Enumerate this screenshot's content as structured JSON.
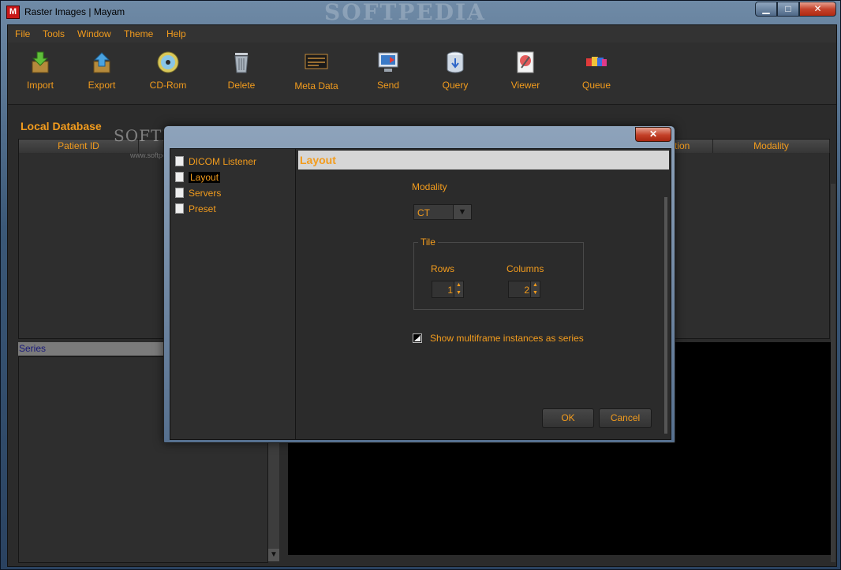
{
  "window": {
    "title": "Raster Images | Mayam",
    "app_icon_letter": "M",
    "watermark": "SOFTPEDIA",
    "controls": {
      "minimize": "▁",
      "maximize": "□",
      "close": "✕"
    }
  },
  "menu": [
    "File",
    "Tools",
    "Window",
    "Theme",
    "Help"
  ],
  "toolbar": [
    {
      "label": "Import",
      "icon": "import-icon"
    },
    {
      "label": "Export",
      "icon": "export-icon"
    },
    {
      "label": "CD-Rom",
      "icon": "cd-rom-icon"
    },
    {
      "label": "Delete",
      "icon": "trash-icon"
    },
    {
      "label": "Meta Data",
      "icon": "meta-data-icon"
    },
    {
      "label": "Send",
      "icon": "send-icon"
    },
    {
      "label": "Query",
      "icon": "query-icon"
    },
    {
      "label": "Viewer",
      "icon": "viewer-icon"
    },
    {
      "label": "Queue",
      "icon": "queue-icon"
    }
  ],
  "local_database": {
    "title": "Local Database",
    "columns": [
      "Patient ID",
      "tion",
      "Modality"
    ]
  },
  "series": {
    "header": "Series"
  },
  "watermark": {
    "text": "SOFTPEDIA",
    "url": "www.softpedia.com"
  },
  "dialog": {
    "close": "✕",
    "tree": [
      "DICOM Listener",
      "Layout",
      "Servers",
      "Preset"
    ],
    "selected": "Layout",
    "panel_title": "Layout",
    "modality_label": "Modality",
    "modality_value": "CT",
    "tile_label": "Tile",
    "rows_label": "Rows",
    "rows_value": "1",
    "columns_label": "Columns",
    "columns_value": "2",
    "checkbox_label": "Show multiframe instances as series",
    "ok": "OK",
    "cancel": "Cancel"
  },
  "colors": {
    "accent": "#f39c1d",
    "background": "#2b2b2b"
  }
}
